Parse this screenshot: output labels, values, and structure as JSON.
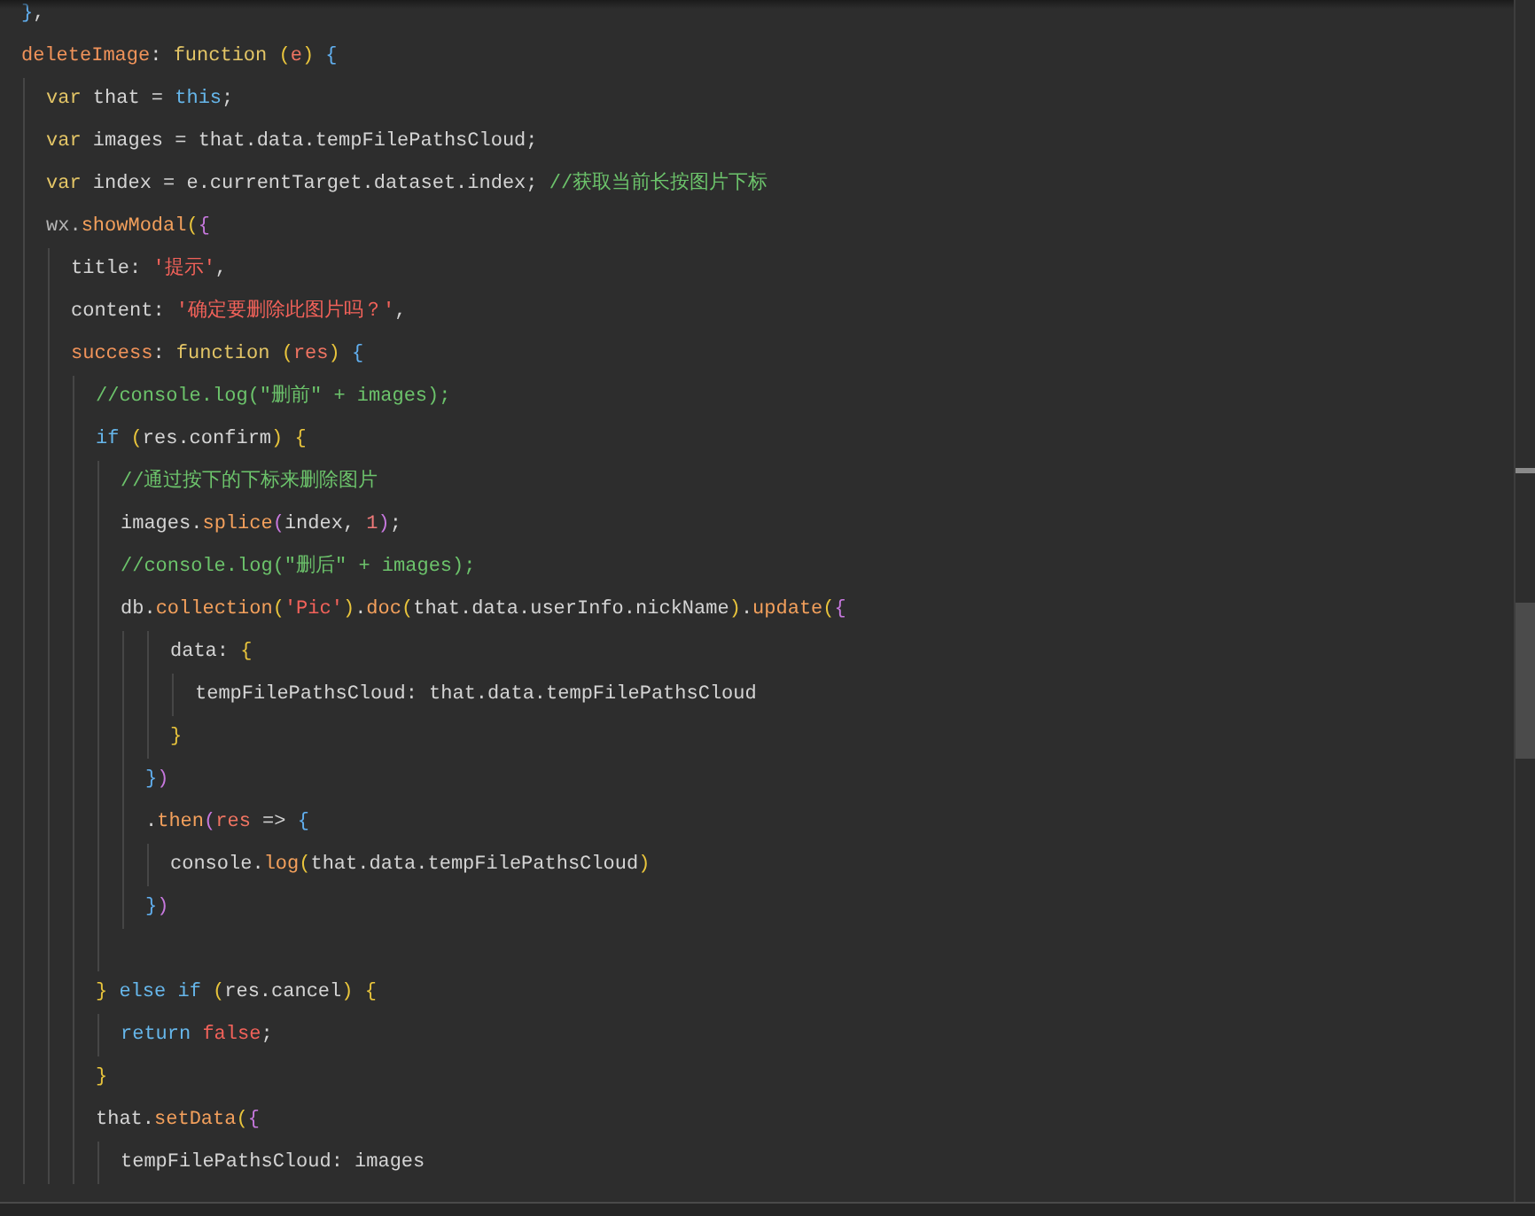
{
  "editor": {
    "lines": [
      {
        "kind": "line",
        "tokens": [
          {
            "kind": "p3",
            "text": "}"
          },
          {
            "kind": "plain",
            "text": ","
          }
        ]
      },
      {
        "kind": "line",
        "tokens": [
          {
            "kind": "prop",
            "text": "deleteImage"
          },
          {
            "kind": "plain",
            "text": ": "
          },
          {
            "kind": "kw",
            "text": "function"
          },
          {
            "kind": "p1",
            "text": " ("
          },
          {
            "kind": "param",
            "text": "e"
          },
          {
            "kind": "p1",
            "text": ")"
          },
          {
            "kind": "p3",
            "text": " {"
          }
        ],
        "children": [
          {
            "kind": "line",
            "tokens": [
              {
                "kind": "kw",
                "text": "var"
              },
              {
                "kind": "plain",
                "text": " that = "
              },
              {
                "kind": "kw2",
                "text": "this"
              },
              {
                "kind": "plain",
                "text": ";"
              }
            ]
          },
          {
            "kind": "line",
            "tokens": [
              {
                "kind": "kw",
                "text": "var"
              },
              {
                "kind": "plain",
                "text": " images = that.data.tempFilePathsCloud;"
              }
            ]
          },
          {
            "kind": "line",
            "tokens": [
              {
                "kind": "kw",
                "text": "var"
              },
              {
                "kind": "plain",
                "text": " index = e.currentTarget.dataset.index; "
              },
              {
                "kind": "cmt",
                "text": "//获取当前长按图片下标"
              }
            ]
          },
          {
            "kind": "line",
            "tokens": [
              {
                "kind": "dim",
                "text": "wx."
              },
              {
                "kind": "method",
                "text": "showModal"
              },
              {
                "kind": "p1",
                "text": "("
              },
              {
                "kind": "p2",
                "text": "{"
              }
            ],
            "children": [
              {
                "kind": "line",
                "tokens": [
                  {
                    "kind": "plain",
                    "text": "title: "
                  },
                  {
                    "kind": "str",
                    "text": "'提示'"
                  },
                  {
                    "kind": "plain",
                    "text": ","
                  }
                ]
              },
              {
                "kind": "line",
                "tokens": [
                  {
                    "kind": "plain",
                    "text": "content: "
                  },
                  {
                    "kind": "str",
                    "text": "'确定要删除此图片吗？'"
                  },
                  {
                    "kind": "plain",
                    "text": ","
                  }
                ]
              },
              {
                "kind": "line",
                "tokens": [
                  {
                    "kind": "prop",
                    "text": "success"
                  },
                  {
                    "kind": "plain",
                    "text": ": "
                  },
                  {
                    "kind": "kw",
                    "text": "function"
                  },
                  {
                    "kind": "p1",
                    "text": " ("
                  },
                  {
                    "kind": "param",
                    "text": "res"
                  },
                  {
                    "kind": "p1",
                    "text": ")"
                  },
                  {
                    "kind": "p3",
                    "text": " {"
                  }
                ],
                "children": [
                  {
                    "kind": "line",
                    "tokens": [
                      {
                        "kind": "cmt",
                        "text": "//console.log(\"删前\" + images);"
                      }
                    ]
                  },
                  {
                    "kind": "line",
                    "tokens": [
                      {
                        "kind": "kw2",
                        "text": "if"
                      },
                      {
                        "kind": "p1",
                        "text": " ("
                      },
                      {
                        "kind": "plain",
                        "text": "res.confirm"
                      },
                      {
                        "kind": "p1",
                        "text": ")"
                      },
                      {
                        "kind": "p1",
                        "text": " {"
                      }
                    ],
                    "children": [
                      {
                        "kind": "line",
                        "tokens": [
                          {
                            "kind": "cmt",
                            "text": "//通过按下的下标来删除图片"
                          }
                        ]
                      },
                      {
                        "kind": "line",
                        "tokens": [
                          {
                            "kind": "plain",
                            "text": "images."
                          },
                          {
                            "kind": "method",
                            "text": "splice"
                          },
                          {
                            "kind": "p2",
                            "text": "("
                          },
                          {
                            "kind": "plain",
                            "text": "index, "
                          },
                          {
                            "kind": "num",
                            "text": "1"
                          },
                          {
                            "kind": "p2",
                            "text": ")"
                          },
                          {
                            "kind": "plain",
                            "text": ";"
                          }
                        ]
                      },
                      {
                        "kind": "line",
                        "tokens": [
                          {
                            "kind": "cmt",
                            "text": "//console.log(\"删后\" + images);"
                          }
                        ]
                      },
                      {
                        "kind": "line",
                        "tokens": [
                          {
                            "kind": "plain",
                            "text": "db."
                          },
                          {
                            "kind": "method",
                            "text": "collection"
                          },
                          {
                            "kind": "p1",
                            "text": "("
                          },
                          {
                            "kind": "str",
                            "text": "'Pic'"
                          },
                          {
                            "kind": "p1",
                            "text": ")"
                          },
                          {
                            "kind": "plain",
                            "text": "."
                          },
                          {
                            "kind": "method",
                            "text": "doc"
                          },
                          {
                            "kind": "p1",
                            "text": "("
                          },
                          {
                            "kind": "plain",
                            "text": "that.data.userInfo.nickName"
                          },
                          {
                            "kind": "p1",
                            "text": ")"
                          },
                          {
                            "kind": "plain",
                            "text": "."
                          },
                          {
                            "kind": "method",
                            "text": "update"
                          },
                          {
                            "kind": "p1",
                            "text": "("
                          },
                          {
                            "kind": "p2",
                            "text": "{"
                          }
                        ],
                        "children": [
                          {
                            "kind": "group",
                            "children": [
                              {
                                "kind": "line",
                                "tokens": [
                                  {
                                    "kind": "plain",
                                    "text": "data: "
                                  },
                                  {
                                    "kind": "p1",
                                    "text": "{"
                                  }
                                ],
                                "children": [
                                  {
                                    "kind": "line",
                                    "tokens": [
                                      {
                                        "kind": "plain",
                                        "text": "tempFilePathsCloud: that.data.tempFilePathsCloud"
                                      }
                                    ]
                                  }
                                ]
                              },
                              {
                                "kind": "line",
                                "tokens": [
                                  {
                                    "kind": "p1",
                                    "text": "}"
                                  }
                                ]
                              }
                            ]
                          },
                          {
                            "kind": "line",
                            "tokens": [
                              {
                                "kind": "p3",
                                "text": "}"
                              },
                              {
                                "kind": "p2",
                                "text": ")"
                              }
                            ]
                          },
                          {
                            "kind": "line",
                            "tokens": [
                              {
                                "kind": "plain",
                                "text": "."
                              },
                              {
                                "kind": "method",
                                "text": "then"
                              },
                              {
                                "kind": "p2",
                                "text": "("
                              },
                              {
                                "kind": "param",
                                "text": "res"
                              },
                              {
                                "kind": "plain",
                                "text": " => "
                              },
                              {
                                "kind": "p3",
                                "text": "{"
                              }
                            ],
                            "children": [
                              {
                                "kind": "line",
                                "tokens": [
                                  {
                                    "kind": "plain",
                                    "text": "console."
                                  },
                                  {
                                    "kind": "method",
                                    "text": "log"
                                  },
                                  {
                                    "kind": "p1",
                                    "text": "("
                                  },
                                  {
                                    "kind": "plain",
                                    "text": "that.data.tempFilePathsCloud"
                                  },
                                  {
                                    "kind": "p1",
                                    "text": ")"
                                  }
                                ]
                              }
                            ]
                          },
                          {
                            "kind": "line",
                            "tokens": [
                              {
                                "kind": "p3",
                                "text": "}"
                              },
                              {
                                "kind": "p2",
                                "text": ")"
                              }
                            ]
                          }
                        ]
                      },
                      {
                        "kind": "blank"
                      }
                    ]
                  },
                  {
                    "kind": "line",
                    "tokens": [
                      {
                        "kind": "p1",
                        "text": "}"
                      },
                      {
                        "kind": "kw2",
                        "text": " else if"
                      },
                      {
                        "kind": "p1",
                        "text": " ("
                      },
                      {
                        "kind": "plain",
                        "text": "res.cancel"
                      },
                      {
                        "kind": "p1",
                        "text": ")"
                      },
                      {
                        "kind": "p1",
                        "text": " {"
                      }
                    ],
                    "children": [
                      {
                        "kind": "line",
                        "tokens": [
                          {
                            "kind": "kw2",
                            "text": "return"
                          },
                          {
                            "kind": "str",
                            "text": " false"
                          },
                          {
                            "kind": "plain",
                            "text": ";"
                          }
                        ]
                      }
                    ]
                  },
                  {
                    "kind": "line",
                    "tokens": [
                      {
                        "kind": "p1",
                        "text": "}"
                      }
                    ]
                  },
                  {
                    "kind": "line",
                    "tokens": [
                      {
                        "kind": "plain",
                        "text": "that."
                      },
                      {
                        "kind": "method",
                        "text": "setData"
                      },
                      {
                        "kind": "p1",
                        "text": "("
                      },
                      {
                        "kind": "p2",
                        "text": "{"
                      }
                    ],
                    "children": [
                      {
                        "kind": "line",
                        "tokens": [
                          {
                            "kind": "plain",
                            "text": "tempFilePathsCloud: images"
                          }
                        ]
                      }
                    ]
                  }
                ]
              }
            ]
          }
        ]
      }
    ]
  }
}
